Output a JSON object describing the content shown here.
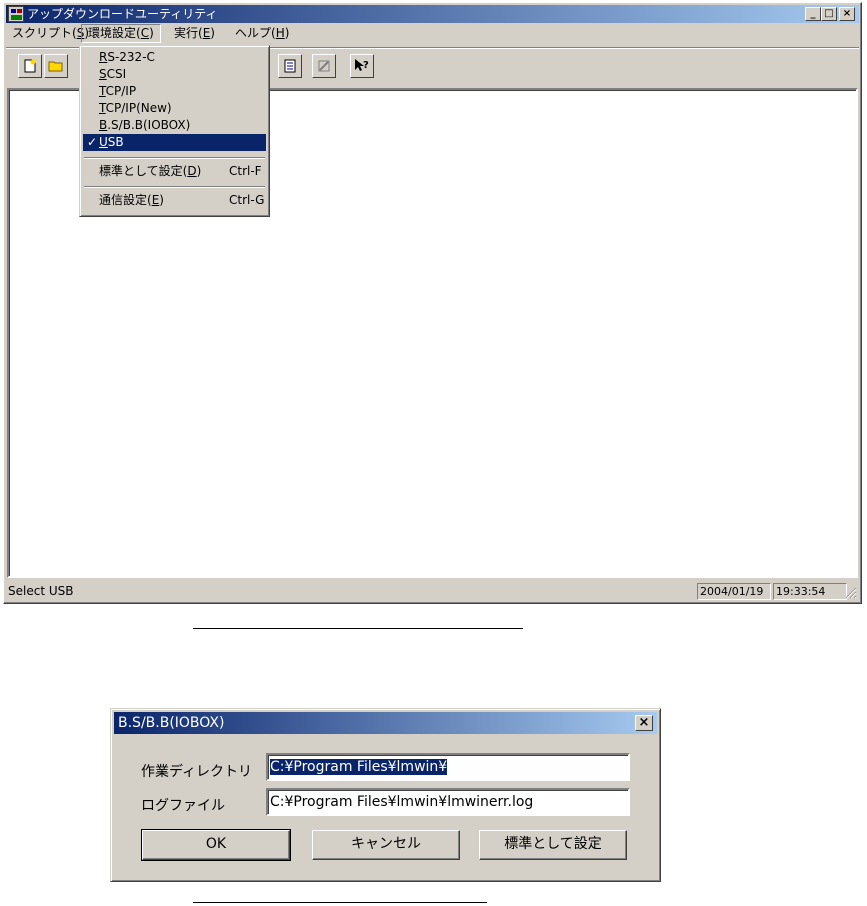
{
  "main_window": {
    "title": "アップダウンロードユーティリティ",
    "menu": [
      {
        "label": "スクリプト(",
        "key": "S",
        "suffix": ")"
      },
      {
        "label": "環境設定(",
        "key": "C",
        "suffix": ")"
      },
      {
        "label": "実行(",
        "key": "E",
        "suffix": ")"
      },
      {
        "label": "ヘルプ(",
        "key": "H",
        "suffix": ")"
      }
    ],
    "caption_buttons": {
      "minimize": "_",
      "maximize": "□",
      "close": "×"
    },
    "dropdown": {
      "items": [
        {
          "key": "R",
          "rest": "S-232-C"
        },
        {
          "key": "S",
          "rest": "CSI"
        },
        {
          "key": "T",
          "rest": "CP/IP"
        },
        {
          "key": "T",
          "rest": "CP/IP(New)"
        },
        {
          "key": "B",
          "rest": ".S/B.B(IOBOX)"
        },
        {
          "key": "U",
          "rest": "SB",
          "checked": true,
          "check": "✓"
        }
      ],
      "actions": [
        {
          "label": "標準として設定(",
          "key": "D",
          "suffix": ")",
          "accel": "Ctrl-F"
        },
        {
          "label": "通信設定(",
          "key": "E",
          "suffix": ")",
          "accel": "Ctrl-G"
        }
      ]
    },
    "toolbar_icons": [
      "new-file-icon",
      "open-folder-icon",
      "list-icon",
      "disabled-pencil-icon",
      "help-pointer-icon"
    ],
    "status": {
      "text": "Select USB",
      "date": "2004/01/19",
      "time": "19:33:54"
    }
  },
  "dialog": {
    "title": "B.S/B.B(IOBOX)",
    "close": "×",
    "work_dir_label": "作業ディレクトリ",
    "work_dir_value": "C:¥Program Files¥lmwin¥",
    "log_file_label": "ログファイル",
    "log_file_value": "C:¥Program Files¥lmwin¥lmwinerr.log",
    "ok_label": "OK",
    "cancel_label": "キャンセル",
    "set_default_label": "標準として設定"
  }
}
